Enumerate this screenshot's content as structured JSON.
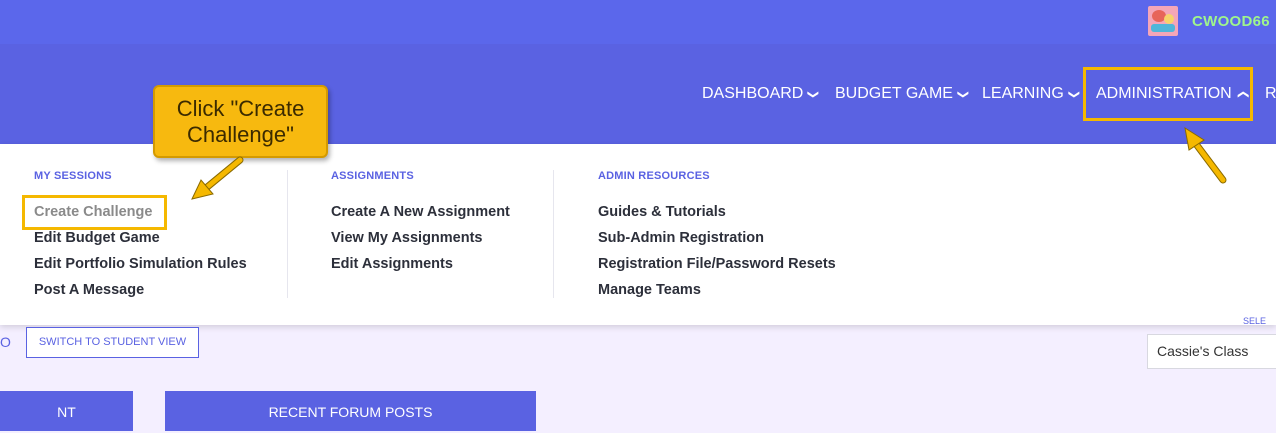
{
  "user": {
    "username": "CWOOD66"
  },
  "nav": {
    "items": [
      {
        "label": "DASHBOARD"
      },
      {
        "label": "BUDGET GAME"
      },
      {
        "label": "LEARNING"
      },
      {
        "label": "ADMINISTRATION"
      },
      {
        "label": "RE"
      }
    ]
  },
  "callout": {
    "line1": "Click \"Create",
    "line2": "Challenge\""
  },
  "dropdown": {
    "columns": [
      {
        "heading": "MY SESSIONS",
        "links": [
          "Create Challenge",
          "Edit Budget Game",
          "Edit Portfolio Simulation Rules",
          "Post A Message"
        ]
      },
      {
        "heading": "ASSIGNMENTS",
        "links": [
          "Create A New Assignment",
          "View My Assignments",
          "Edit Assignments"
        ]
      },
      {
        "heading": "ADMIN RESOURCES",
        "links": [
          "Guides & Tutorials",
          "Sub-Admin Registration",
          "Registration File/Password Resets",
          "Manage Teams"
        ]
      }
    ]
  },
  "page": {
    "left_partial": "O",
    "switch_button": "SWITCH TO STUDENT VIEW",
    "select_label": "SELE",
    "class_select": "Cassie's Class",
    "panels": [
      "NT",
      "RECENT FORUM POSTS"
    ]
  },
  "colors": {
    "topbar": "#5b67eb",
    "navbar": "#5a62e2",
    "highlight": "#f5b800",
    "username": "#9ff58c"
  }
}
